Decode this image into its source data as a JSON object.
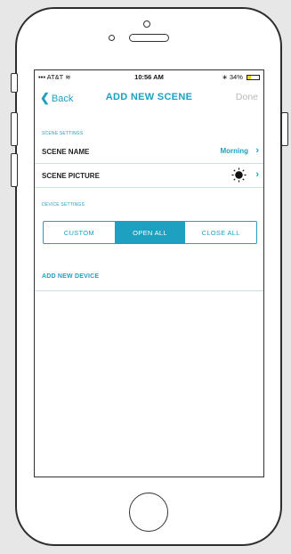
{
  "status_bar": {
    "carrier": "AT&T",
    "time": "10:56 AM",
    "battery": "34%",
    "battery_level": 0.34
  },
  "nav": {
    "back_label": "Back",
    "title": "ADD NEW SCENE",
    "done_label": "Done"
  },
  "scene_settings": {
    "header": "SCENE SETTINGS",
    "scene_name": {
      "label": "SCENE NAME",
      "value": "Morning"
    },
    "scene_picture": {
      "label": "SCENE PICTURE",
      "icon": "sun-icon"
    }
  },
  "device_settings": {
    "header": "DEVICE SETTINGS",
    "segments": [
      "CUSTOM",
      "OPEN ALL",
      "CLOSE ALL"
    ],
    "selected": "OPEN ALL"
  },
  "add_device_label": "ADD NEW DEVICE",
  "colors": {
    "accent": "#1ea1c1",
    "done_disabled": "#b9b9b9",
    "battery": "#f4d21f"
  }
}
